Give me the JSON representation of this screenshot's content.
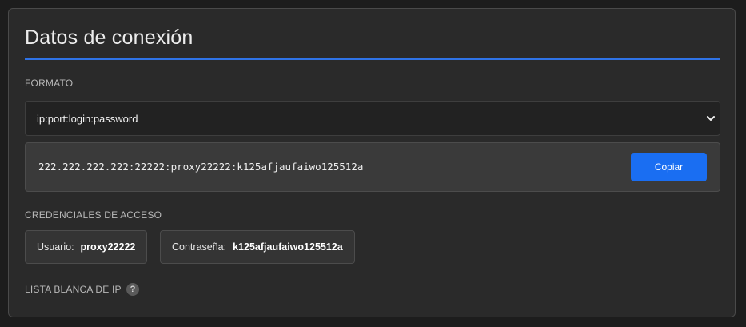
{
  "header": {
    "title": "Datos de conexión"
  },
  "format": {
    "label": "FORMATO",
    "selected": "ip:port:login:password"
  },
  "proxy": {
    "string": "222.222.222.222:22222:proxy22222:k125afjaufaiwo125512a",
    "copy_label": "Copiar"
  },
  "credentials": {
    "label": "CREDENCIALES DE ACCESO",
    "user_label": "Usuario:",
    "user_value": "proxy22222",
    "pass_label": "Contraseña:",
    "pass_value": "k125afjaufaiwo125512a"
  },
  "whitelist": {
    "label": "LISTA BLANCA DE IP",
    "help_glyph": "?"
  },
  "colors": {
    "accent": "#1a6ef2",
    "rule": "#2f73e6",
    "panel": "#2a2a2a",
    "background": "#1d1d1d"
  },
  "icons": {
    "select_arrow": "chevron-down-icon",
    "help": "question-mark-icon"
  }
}
